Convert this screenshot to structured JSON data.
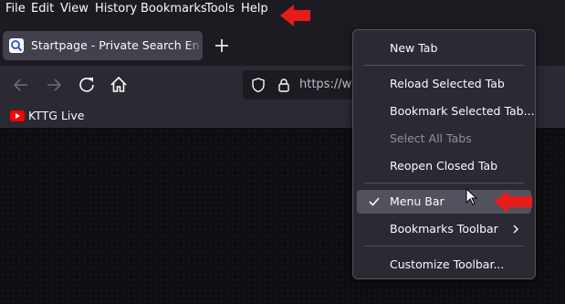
{
  "menubar": {
    "items": [
      {
        "label": "File"
      },
      {
        "label": "Edit"
      },
      {
        "label": "View"
      },
      {
        "label": "History"
      },
      {
        "label": "Bookmarks"
      },
      {
        "label": "Tools"
      },
      {
        "label": "Help"
      }
    ]
  },
  "tabs": [
    {
      "title": "Startpage - Private Search Engine",
      "favicon": "startpage-icon",
      "active": true
    }
  ],
  "newtab": {
    "icon": "plus-icon"
  },
  "navbar": {
    "icons": [
      "back-arrow-icon",
      "forward-arrow-icon",
      "reload-icon",
      "home-icon"
    ],
    "url": "https://ww"
  },
  "bookmarks": [
    {
      "label": "KTTG Live",
      "icon": "youtube-icon"
    }
  ],
  "context_menu": {
    "items": [
      {
        "label": "New Tab"
      },
      {
        "label": "Reload Selected Tab"
      },
      {
        "label": "Bookmark Selected Tab..."
      },
      {
        "label": "Select All Tabs",
        "disabled": true
      },
      {
        "label": "Reopen Closed Tab"
      },
      {
        "label": "Menu Bar",
        "checked": true,
        "hover": true
      },
      {
        "label": "Bookmarks Toolbar",
        "submenu": true
      },
      {
        "label": "Customize Toolbar..."
      }
    ]
  },
  "colors": {
    "accent_arrow": "#e81b1b",
    "menu_bg": "#2b2a33",
    "hover": "#52525e"
  }
}
